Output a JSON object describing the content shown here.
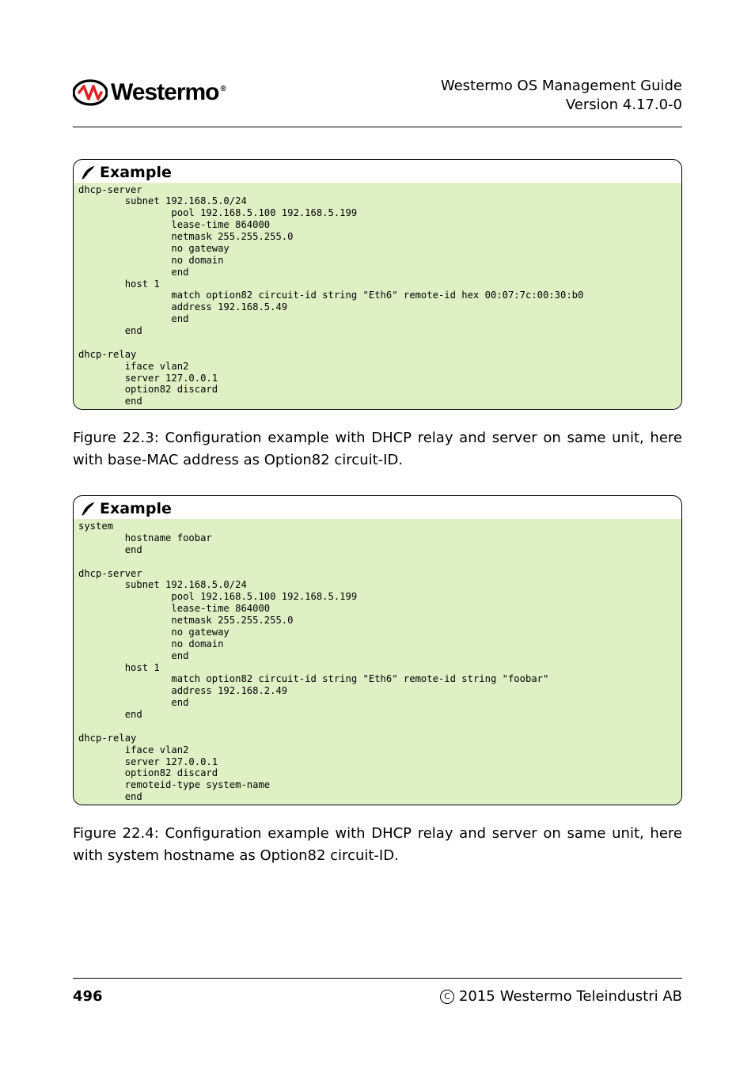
{
  "header": {
    "logo_text": "Westermo",
    "title_line1": "Westermo OS Management Guide",
    "title_line2": "Version 4.17.0-0"
  },
  "examples": [
    {
      "label": "Example",
      "code": "dhcp-server\n        subnet 192.168.5.0/24\n                pool 192.168.5.100 192.168.5.199\n                lease-time 864000\n                netmask 255.255.255.0\n                no gateway\n                no domain\n                end\n        host 1\n                match option82 circuit-id string \"Eth6\" remote-id hex 00:07:7c:00:30:b0\n                address 192.168.5.49\n                end\n        end\n\ndhcp-relay\n        iface vlan2\n        server 127.0.0.1\n        option82 discard\n        end"
    },
    {
      "label": "Example",
      "code": "system\n        hostname foobar\n        end\n\ndhcp-server\n        subnet 192.168.5.0/24\n                pool 192.168.5.100 192.168.5.199\n                lease-time 864000\n                netmask 255.255.255.0\n                no gateway\n                no domain\n                end\n        host 1\n                match option82 circuit-id string \"Eth6\" remote-id string \"foobar\"\n                address 192.168.2.49\n                end\n        end\n\ndhcp-relay\n        iface vlan2\n        server 127.0.0.1\n        option82 discard\n        remoteid-type system-name\n        end"
    }
  ],
  "captions": [
    "Figure 22.3: Configuration example with DHCP relay and server on same unit, here with base-MAC address as Option82 circuit-ID.",
    "Figure 22.4: Configuration example with DHCP relay and server on same unit, here with system hostname as Option82 circuit-ID."
  ],
  "footer": {
    "page": "496",
    "copyright_year": "2015",
    "copyright_holder": "Westermo Teleindustri AB"
  }
}
